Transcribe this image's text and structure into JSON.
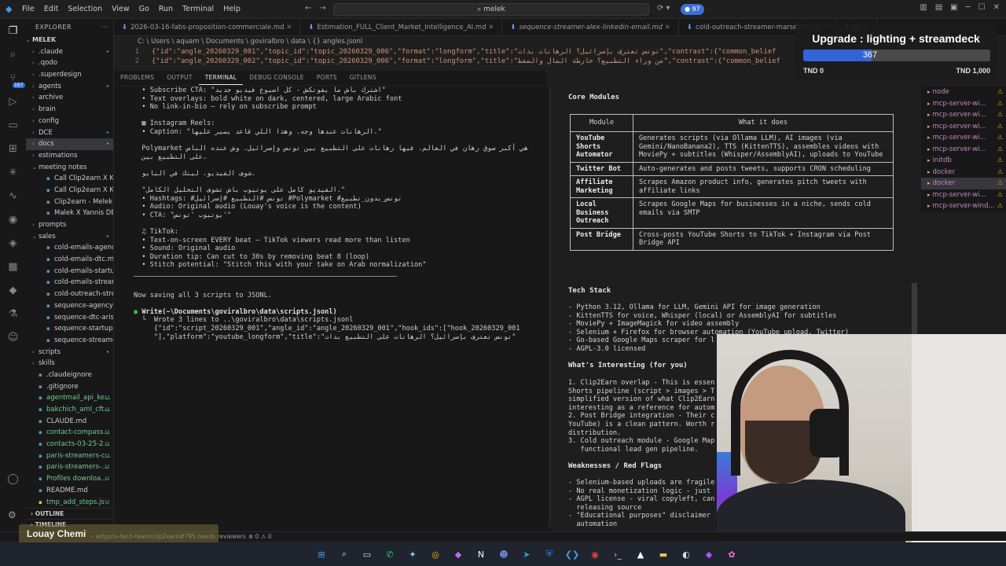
{
  "menu": [
    "File",
    "Edit",
    "Selection",
    "View",
    "Go",
    "Run",
    "Terminal",
    "Help"
  ],
  "search": {
    "text": "melek"
  },
  "notifications": {
    "count": "97"
  },
  "activity_badge": "167",
  "explorer": {
    "title": "EXPLORER",
    "root": "MELEK",
    "items": [
      {
        "label": ".claude",
        "type": "folder",
        "mark": "•",
        "markColor": "#73c991"
      },
      {
        "label": ".qodo",
        "type": "folder",
        "mark": "",
        "markColor": ""
      },
      {
        "label": ".superdesign",
        "type": "folder",
        "mark": "",
        "markColor": ""
      },
      {
        "label": "agents",
        "type": "folder",
        "mark": "•",
        "markColor": "#73c991"
      },
      {
        "label": "archive",
        "type": "folder",
        "mark": "",
        "markColor": ""
      },
      {
        "label": "brain",
        "type": "folder",
        "mark": "",
        "markColor": ""
      },
      {
        "label": "config",
        "type": "folder",
        "mark": "",
        "markColor": ""
      },
      {
        "label": "DCE",
        "type": "folder",
        "mark": "•",
        "markColor": "#73c991"
      },
      {
        "label": "docs",
        "type": "folder",
        "mark": "•",
        "markColor": "#73c991",
        "selected": true
      },
      {
        "label": "estimations",
        "type": "folder",
        "mark": "",
        "markColor": ""
      },
      {
        "label": "meeting notes",
        "type": "folder-open",
        "mark": "",
        "markColor": ""
      },
      {
        "label": "Call Clip2earn X Kos...",
        "type": "file",
        "mark": "",
        "markColor": ""
      },
      {
        "label": "Call Clip2earn X Kos...",
        "type": "file",
        "mark": "",
        "markColor": ""
      },
      {
        "label": "Clip2earn - Melek G...",
        "type": "file",
        "mark": "",
        "markColor": ""
      },
      {
        "label": "Malek X Yannis DEBR...",
        "type": "file",
        "mark": "",
        "markColor": ""
      },
      {
        "label": "prompts",
        "type": "folder",
        "mark": "",
        "markColor": ""
      },
      {
        "label": "sales",
        "type": "folder-open",
        "mark": "•",
        "markColor": "#73c991"
      },
      {
        "label": "cold-emails-agency...",
        "type": "file",
        "mark": "",
        "markColor": ""
      },
      {
        "label": "cold-emails-dtc.md",
        "type": "file",
        "mark": "",
        "markColor": ""
      },
      {
        "label": "cold-emails-startup...",
        "type": "file",
        "mark": "",
        "markColor": ""
      },
      {
        "label": "cold-emails-streame...",
        "type": "file",
        "mark": "",
        "markColor": ""
      },
      {
        "label": "cold-outreach-strea...",
        "type": "file",
        "mark": "",
        "markColor": ""
      },
      {
        "label": "sequence-agency-sa...",
        "type": "file",
        "mark": "",
        "markColor": ""
      },
      {
        "label": "sequence-dtc-aris-lin...",
        "type": "file",
        "mark": "",
        "markColor": ""
      },
      {
        "label": "sequence-startup-bil...",
        "type": "file",
        "mark": "",
        "markColor": ""
      },
      {
        "label": "sequence-streamer-...",
        "type": "file",
        "mark": "",
        "markColor": ""
      },
      {
        "label": "scripts",
        "type": "folder",
        "mark": "•",
        "markColor": "#73c991"
      },
      {
        "label": "skills",
        "type": "folder",
        "mark": "",
        "markColor": ""
      },
      {
        "label": ".claudeignore",
        "type": "file",
        "mark": "",
        "markColor": ""
      },
      {
        "label": ".gitignore",
        "type": "file",
        "mark": "",
        "markColor": ""
      },
      {
        "label": "agentmail_api_ke...",
        "type": "file",
        "mark": "U",
        "markColor": "#73c991"
      },
      {
        "label": "bakchich_aml_cft...",
        "type": "file",
        "mark": "U",
        "markColor": "#73c991"
      },
      {
        "label": "CLAUDE.md",
        "type": "file",
        "mark": "",
        "markColor": ""
      },
      {
        "label": "contact-compass...",
        "type": "file",
        "mark": "U",
        "markColor": "#73c991"
      },
      {
        "label": "contacts-03-25-2...",
        "type": "file",
        "mark": "U",
        "markColor": "#73c991"
      },
      {
        "label": "paris-streamers-c...",
        "type": "file",
        "mark": "U",
        "markColor": "#73c991"
      },
      {
        "label": "paris-streamers-...",
        "type": "file",
        "mark": "U",
        "markColor": "#73c991"
      },
      {
        "label": "Profiles downloa...",
        "type": "file",
        "mark": "U",
        "markColor": "#73c991"
      },
      {
        "label": "README.md",
        "type": "file",
        "mark": "",
        "markColor": ""
      },
      {
        "label": "tmp_add_steps.js",
        "type": "file",
        "mark": "U",
        "markColor": "#73c991"
      }
    ],
    "outline": "OUTLINE",
    "timeline": "TIMELINE"
  },
  "tabs": [
    {
      "label": "2026-03-16-fabs-proposition-commerciale.md",
      "italic": false
    },
    {
      "label": "Estimation_FULL_Client_Market_Intelligence_AI.md",
      "italic": false
    },
    {
      "label": "sequence-streamer-alex-linkedin-email.md",
      "italic": true
    },
    {
      "label": "cold-outreach-streamer-marseille.md",
      "italic": false
    },
    {
      "label": "Se",
      "italic": false
    }
  ],
  "breadcrumb": "C: \\ Users \\ aquam \\ Documents \\ goviralbro \\ data \\ {} angles.jsonl",
  "code": [
    {
      "num": "1",
      "text": "{\"id\":\"angle_20260329_001\",\"topic_id\":\"topic_20260329_006\",\"format\":\"longform\",\"title\":\"تونس تعترف بإسرائيل؟ الرهانات بدات\",\"contrast\":{\"common_belief"
    },
    {
      "num": "2",
      "text": "{\"id\":\"angle_20260329_002\",\"topic_id\":\"topic_20260329_006\",\"format\":\"longform\",\"title\":\"من وراء التطبيع؟ خارطة المال والضغط\",\"contrast\":{\"common_belief"
    }
  ],
  "panel_tabs": [
    "PROBLEMS",
    "OUTPUT",
    "TERMINAL",
    "DEBUG CONSOLE",
    "PORTS",
    "GITLENS"
  ],
  "terminal": {
    "lines_a": [
      "  • Subscribe CTA: \"اشترك باش ما يفوتكش - كل أسبوع فيديو جديد\"",
      "  • Text overlays: bold white on dark, centered, large Arabic font",
      "  • No link-in-bio — rely on subscribe prompt",
      "",
      "  ▦ Instagram Reels:",
      "  • Caption: \"الرهانات عندها وجه. وهذا اللي قاعد يصير عليها.\"",
      "",
      "  Polymarket هي أكبر سوق رهان في العالم. فيها رهانات على التطبيع بين تونس وإسرائيل. وش عنده الناس",
      "  على التطبيع بين.",
      "",
      "  شوف الفيديو. لينك في البايو.",
      "",
      "  \"الفيديو كامل على يوتيوب باش تشوف التحليل الكامل.\"",
      "  • Hashtags: #تونس #التطبيع #إسرائيل #Polymarket #تونس_بدون_تطبيع",
      "  • Audio: Original audio (Louay's voice is the content)",
      "  • CTA: \"يوتيوب 'تونس'\"",
      "",
      "  ♫ TikTok:",
      "  • Text-on-screen EVERY beat — TikTok viewers read more than listen",
      "  • Sound: Original audio",
      "  • Duration tip: Can cut to 30s by removing beat 8 (loop)",
      "  • Stitch potential: \"Stitch this with your take on Arab normalization\""
    ],
    "saving": "Now saving all 3 scripts to JSONL.",
    "write_cmd": "Write(~\\Documents\\goviralbro\\data\\scripts.jsonl)",
    "write_result": "  └  Wrote 3 lines to ..\\goviralbro\\data\\scripts.jsonl",
    "write_l1": "     {\"id\":\"script_20260329_001\",\"angle_id\":\"angle_20260329_001\",\"hook_ids\":[\"hook_20260329_001",
    "write_l2": "     \"],\"platform\":\"youtube_longform\",\"title\":\"تونس تعترف بإسرائيل؟ الرهانات على التطبيع بدات\""
  },
  "markdown": {
    "core_title": "Core Modules",
    "table_headers": [
      "Module",
      "What it does"
    ],
    "rows": [
      {
        "module": "YouTube Shorts Automator",
        "desc": "Generates scripts (via Ollama LLM), AI images (via Gemini/NanoBanana2), TTS (KittenTTS), assembles videos with MoviePy + subtitles (Whisper/AssemblyAI), uploads to YouTube"
      },
      {
        "module": "Twitter Bot",
        "desc": "Auto-generates and posts tweets, supports CRON scheduling"
      },
      {
        "module": "Affiliate Marketing",
        "desc": "Scrapes Amazon product info, generates pitch tweets with affiliate links"
      },
      {
        "module": "Local Business Outreach",
        "desc": "Scrapes Google Maps for businesses in a niche, sends cold emails via SMTP"
      },
      {
        "module": "Post Bridge",
        "desc": "Cross-posts YouTube Shorts to TikTok + Instagram via Post Bridge API"
      }
    ],
    "tech_title": "Tech Stack",
    "tech": [
      "- Python 3.12, Ollama for LLM, Gemini API for image generation",
      "- KittenTTS for voice, Whisper (local) or AssemblyAI for subtitles",
      "- MoviePy + ImageMagick for video assembly",
      "- Selenium + Firefox for browser automation (YouTube upload, Twitter)",
      "- Go-based Google Maps scraper for l",
      "- AGPL-3.0 licensed"
    ],
    "interesting_title": "What's Interesting (for you)",
    "interesting": [
      "1. Clip2Earn overlap - This is essen",
      "Shorts pipeline (script > images > T",
      "simplified version of what Clip2Earn",
      "interesting as a reference for autom",
      "2. Post Bridge integration - Their c",
      "YouTube) is a clean pattern. Worth r",
      "distribution.",
      "3. Cold outreach module - Google Map",
      "   functional lead gen pipeline."
    ],
    "weak_title": "Weaknesses / Red Flags",
    "weak": [
      "- Selenium-based uploads are fragile",
      "- No real monetization logic - just",
      "- AGPL license - viral copyleft, can",
      "  releasing source",
      "- \"Educational purposes\" disclaimer",
      "  automation"
    ]
  },
  "right_list": [
    {
      "label": "node",
      "selected": false
    },
    {
      "label": "mcp-server-wi...",
      "selected": false
    },
    {
      "label": "mcp-server-wi...",
      "selected": false
    },
    {
      "label": "mcp-server-wi...",
      "selected": false
    },
    {
      "label": "mcp-server-wi...",
      "selected": false
    },
    {
      "label": "mcp-server-wi...",
      "selected": false
    },
    {
      "label": "initdb",
      "selected": false
    },
    {
      "label": "docker",
      "selected": false
    },
    {
      "label": "docker",
      "selected": true
    },
    {
      "label": "mcp-server-wi...",
      "selected": false
    },
    {
      "label": "mcp-server-wind...",
      "selected": false
    }
  ],
  "upgrade": {
    "title": "Upgrade : lighting + streamdeck",
    "current": "367",
    "progress": 0.367,
    "min": "TND 0",
    "max": "TND 1,000",
    "fill_color": "#3465d8"
  },
  "status": {
    "branch": "artguru-tech-team/clip2earn#795 needs reviewers",
    "problems": "⊗ 0 ⚠ 0"
  },
  "streamer_name": "Louay Chemi",
  "taskbar_icons": [
    "windows-start-icon",
    "search-icon",
    "task-view-icon",
    "whatsapp-icon",
    "copilot-icon",
    "chrome-dev-icon",
    "app-icon",
    "notion-icon",
    "discord-icon",
    "telegram-icon",
    "bitwarden-icon",
    "vscode-icon",
    "chrome-icon",
    "terminal-icon",
    "app2-icon",
    "file-explorer-icon",
    "obs-icon",
    "app3-icon",
    "app4-icon"
  ]
}
